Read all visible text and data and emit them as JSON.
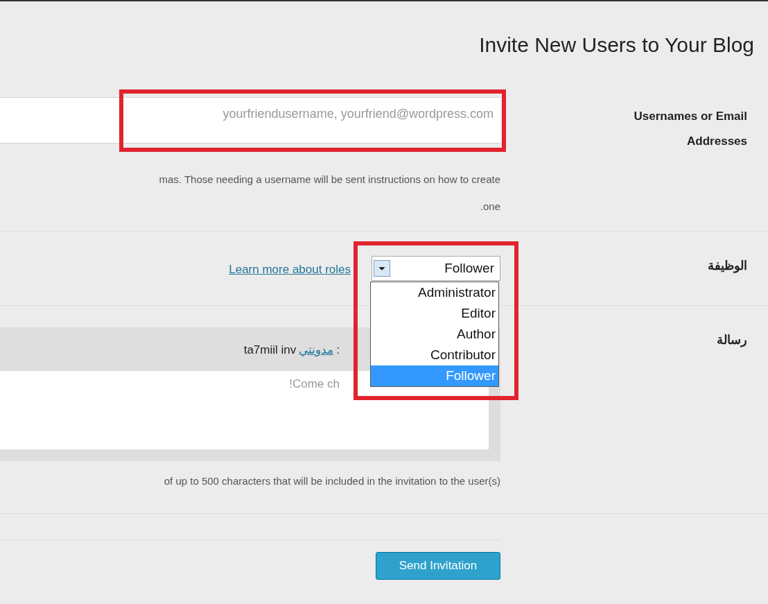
{
  "title": "Invite New Users to Your Blog",
  "usernames": {
    "label": "Usernames or Email Addresses",
    "placeholder": "yourfriendusername, yourfriend@wordpress.com",
    "hint_lines": [
      "mas. Those needing a username will be sent instructions on how to create",
      ".one"
    ]
  },
  "role": {
    "label": "الوظيفة",
    "link": "Learn more about roles",
    "value": "Follower",
    "expanded": true,
    "options": [
      {
        "label": "Administrator",
        "selected": false
      },
      {
        "label": "Editor",
        "selected": false
      },
      {
        "label": "Author",
        "selected": false
      },
      {
        "label": "Contributor",
        "selected": false
      },
      {
        "label": "Follower",
        "selected": true
      }
    ]
  },
  "message": {
    "label": "رسالة",
    "header_text": "ta7miil inv",
    "header_link": "مدونتي",
    "header_colon": ":",
    "body": "!Come ch",
    "hint": "of up to 500 characters that will be included in the invitation to the user(s)"
  },
  "submit": "Send Invitation"
}
